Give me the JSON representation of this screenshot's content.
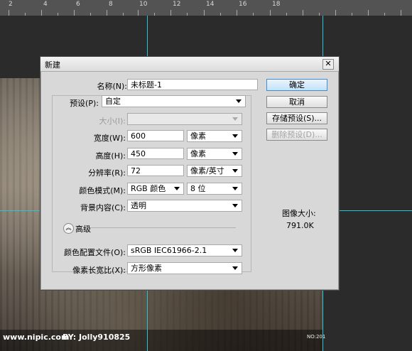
{
  "ruler": {
    "labels": [
      "2",
      "4",
      "6",
      "8",
      "10",
      "12",
      "14",
      "16",
      "18"
    ]
  },
  "watermark": {
    "site": "www.nipic.com",
    "author": "BY: Jolly910825",
    "number": "NO:201"
  },
  "dialog": {
    "title": "新建",
    "close_glyph": "✕",
    "name_label": "名称(N):",
    "name_value": "未标题-1",
    "preset_label": "预设(P):",
    "preset_value": "自定",
    "size_label": "大小(I):",
    "width_label": "宽度(W):",
    "width_value": "600",
    "width_unit": "像素",
    "height_label": "高度(H):",
    "height_value": "450",
    "height_unit": "像素",
    "resolution_label": "分辨率(R):",
    "resolution_value": "72",
    "resolution_unit": "像素/英寸",
    "color_mode_label": "颜色模式(M):",
    "color_mode_value": "RGB 颜色",
    "bit_depth_value": "8 位",
    "background_label": "背景内容(C):",
    "background_value": "透明",
    "advanced_label": "高级",
    "advanced_icon": "︽",
    "color_profile_label": "颜色配置文件(O):",
    "color_profile_value": "sRGB IEC61966-2.1",
    "pixel_aspect_label": "像素长宽比(X):",
    "pixel_aspect_value": "方形像素",
    "buttons": {
      "ok": "确定",
      "cancel": "取消",
      "save_preset": "存储预设(S)...",
      "delete_preset": "删除预设(D)..."
    },
    "image_size_label": "图像大小:",
    "image_size_value": "791.0K"
  }
}
